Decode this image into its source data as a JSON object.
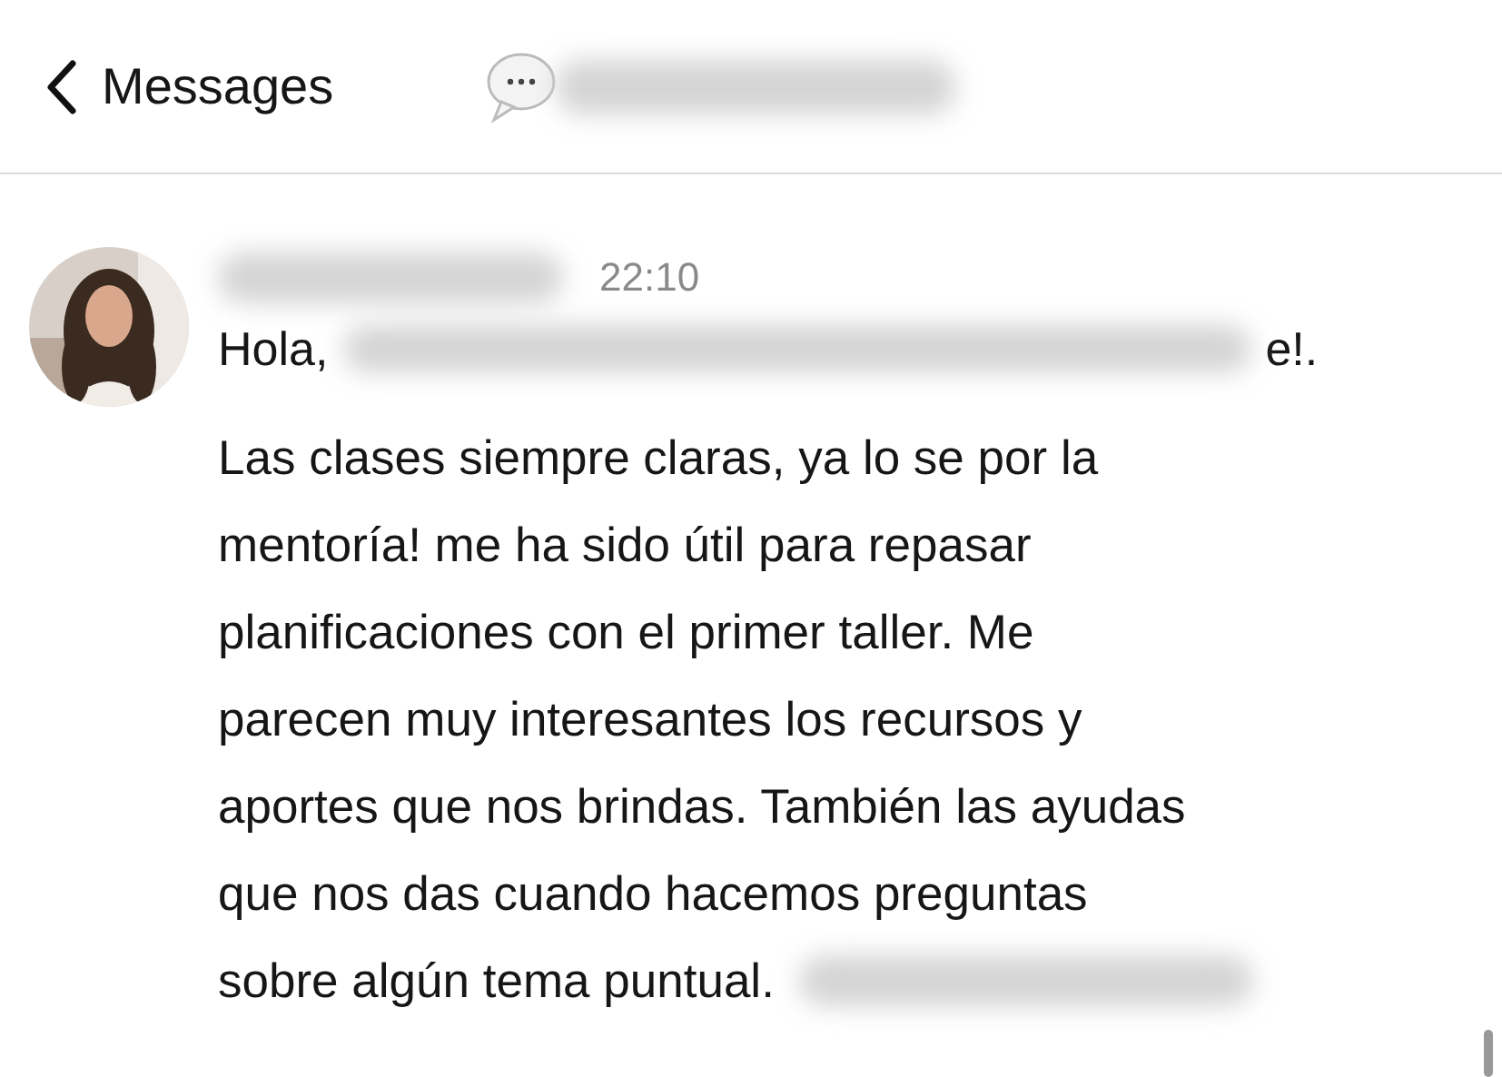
{
  "header": {
    "back_label": "Messages"
  },
  "message": {
    "time": "22:10",
    "greeting_start": "Hola,",
    "greeting_end": "e!.",
    "lines": [
      "Las clases siempre claras, ya lo se por la",
      "mentoría! me ha sido útil para repasar",
      "planificaciones con el primer taller. Me",
      "parecen muy interesantes los recursos y",
      "aportes que nos brindas. También las ayudas",
      "que nos das cuando hacemos preguntas",
      "sobre algún tema puntual."
    ]
  }
}
